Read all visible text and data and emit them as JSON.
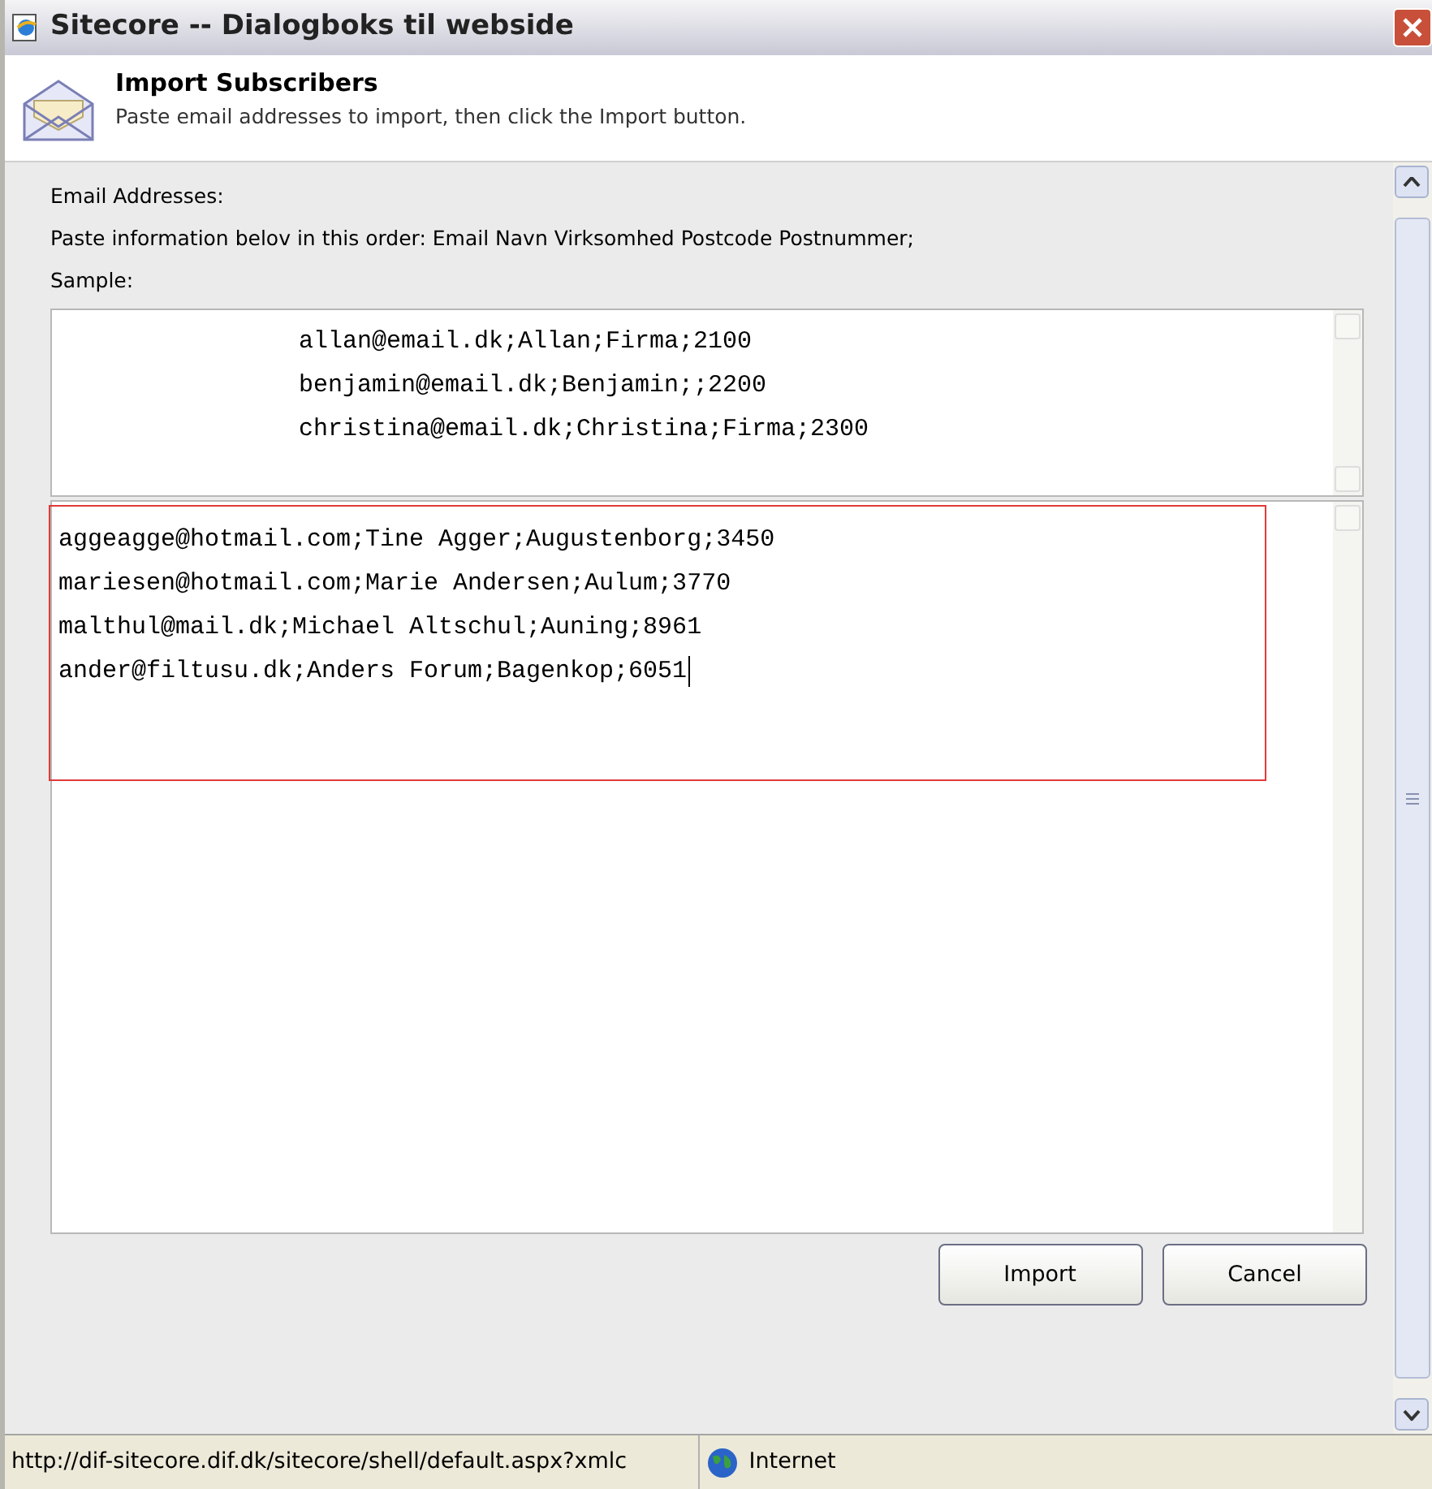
{
  "window": {
    "title": "Sitecore -- Dialogboks til webside"
  },
  "header": {
    "title": "Import Subscribers",
    "subtitle": "Paste email addresses to import, then click the Import button."
  },
  "labels": [
    "Email Addresses:",
    "Paste information belov in this order: Email Navn Virksomhed Postcode Postnummer;",
    "Sample:"
  ],
  "sample_lines": [
    "allan@email.dk;Allan;Firma;2100",
    "benjamin@email.dk;Benjamin;;2200",
    "christina@email.dk;Christina;Firma;2300"
  ],
  "input_lines": [
    "aggeagge@hotmail.com;Tine Agger;Augustenborg;3450",
    "mariesen@hotmail.com;Marie Andersen;Aulum;3770",
    "malthul@mail.dk;Michael Altschul;Auning;8961",
    "ander@filtusu.dk;Anders Forum;Bagenkop;6051"
  ],
  "buttons": [
    "Import",
    "Cancel"
  ],
  "status_bar": {
    "url": "http://dif-sitecore.dif.dk/sitecore/shell/default.aspx?xmlc",
    "zone": "Internet"
  }
}
